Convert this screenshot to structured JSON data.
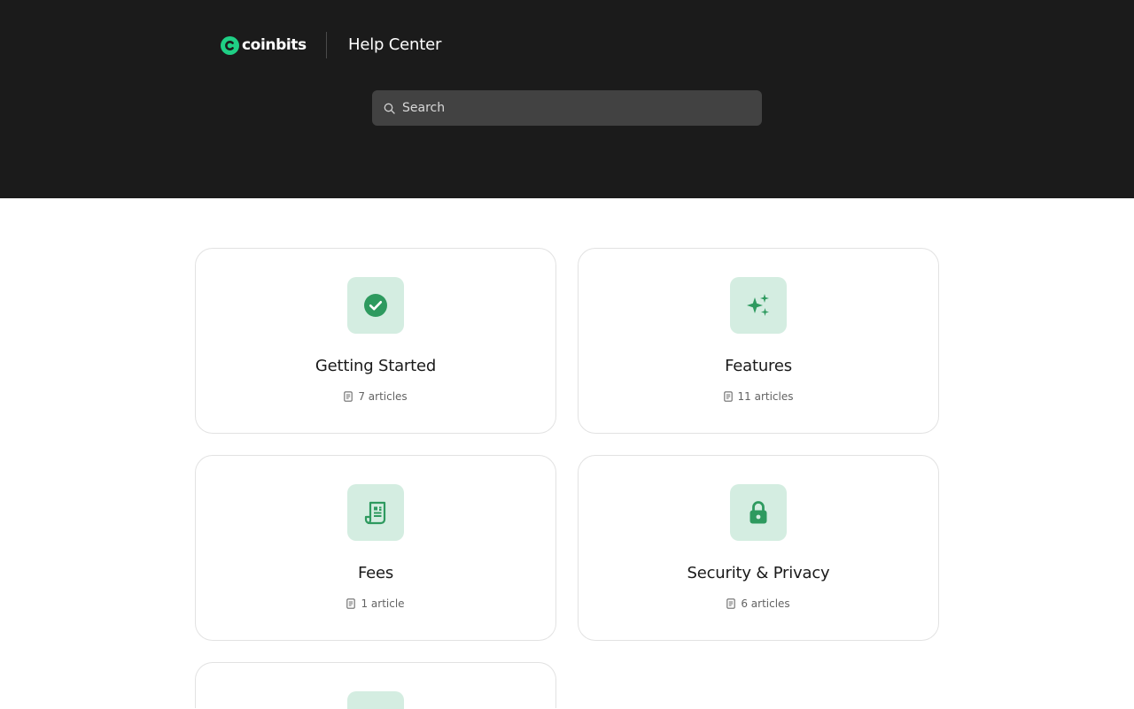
{
  "header": {
    "brand_name": "coinbits",
    "section_title": "Help Center",
    "search": {
      "placeholder": "Search",
      "value": ""
    }
  },
  "colors": {
    "header_bg": "#1b1b1b",
    "brand_green": "#1fcf85",
    "icon_green": "#2e9a5f",
    "icon_tile_bg": "#d4ede1"
  },
  "collections": [
    {
      "title": "Getting Started",
      "count": "7 articles",
      "icon": "check-circle-icon"
    },
    {
      "title": "Features",
      "count": "11 articles",
      "icon": "sparkles-icon"
    },
    {
      "title": "Fees",
      "count": "1 article",
      "icon": "receipt-icon"
    },
    {
      "title": "Security & Privacy",
      "count": "6 articles",
      "icon": "lock-icon"
    },
    {
      "title": "",
      "count": "",
      "icon": ""
    }
  ]
}
